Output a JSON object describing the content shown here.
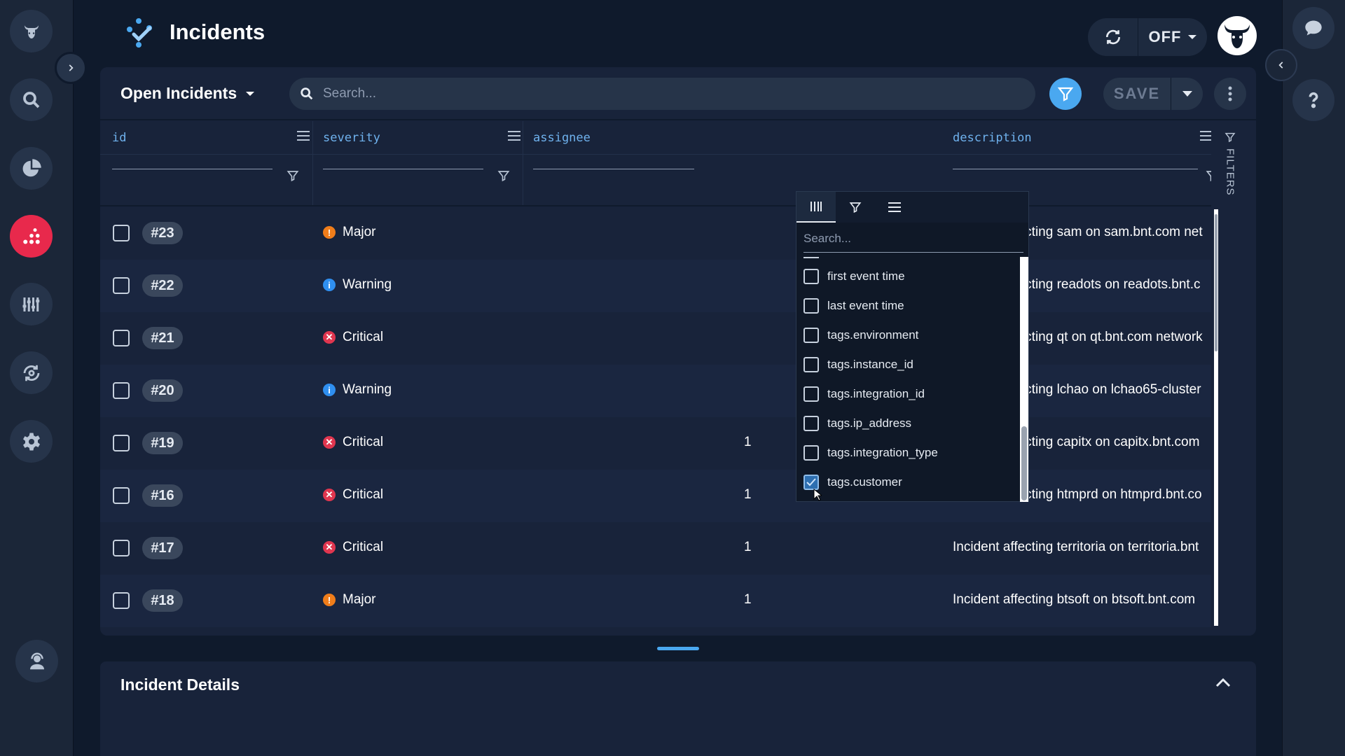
{
  "app": {
    "title": "Incidents"
  },
  "header": {
    "live_label": "OFF"
  },
  "toolbar": {
    "view_name": "Open Incidents",
    "search_placeholder": "Search...",
    "save_label": "SAVE"
  },
  "grid": {
    "columns": [
      "id",
      "severity",
      "assignee",
      "description"
    ],
    "filters_label": "FILTERS",
    "rows": [
      {
        "id": "#23",
        "severity": "Major",
        "sev_type": "major",
        "count": "",
        "description": "Incident affecting sam on sam.bnt.com net"
      },
      {
        "id": "#22",
        "severity": "Warning",
        "sev_type": "warning",
        "count": "",
        "description": "Incident affecting readots on readots.bnt.c"
      },
      {
        "id": "#21",
        "severity": "Critical",
        "sev_type": "critical",
        "count": "",
        "description": "Incident affecting qt on qt.bnt.com network"
      },
      {
        "id": "#20",
        "severity": "Warning",
        "sev_type": "warning",
        "count": "",
        "description": "Incident affecting lchao on lchao65-cluster"
      },
      {
        "id": "#19",
        "severity": "Critical",
        "sev_type": "critical",
        "count": "1",
        "description": "Incident affecting capitx on capitx.bnt.com"
      },
      {
        "id": "#16",
        "severity": "Critical",
        "sev_type": "critical",
        "count": "1",
        "description": "Incident affecting htmprd on htmprd.bnt.co"
      },
      {
        "id": "#17",
        "severity": "Critical",
        "sev_type": "critical",
        "count": "1",
        "description": "Incident affecting territoria on territoria.bnt"
      },
      {
        "id": "#18",
        "severity": "Major",
        "sev_type": "major",
        "count": "1",
        "description": "Incident affecting btsoft on btsoft.bnt.com"
      }
    ]
  },
  "column_menu": {
    "search_placeholder": "Search...",
    "items": [
      {
        "label": "first event time",
        "checked": false
      },
      {
        "label": "last event time",
        "checked": false
      },
      {
        "label": "tags.environment",
        "checked": false
      },
      {
        "label": "tags.instance_id",
        "checked": false
      },
      {
        "label": "tags.integration_id",
        "checked": false
      },
      {
        "label": "tags.ip_address",
        "checked": false
      },
      {
        "label": "tags.integration_type",
        "checked": false
      },
      {
        "label": "tags.customer",
        "checked": true
      }
    ]
  },
  "details": {
    "title": "Incident Details"
  },
  "colors": {
    "accent": "#4aa8f0",
    "active_nav": "#e8294c",
    "critical": "#e0364f",
    "major": "#f07d1a",
    "warning": "#2f8ff0"
  }
}
